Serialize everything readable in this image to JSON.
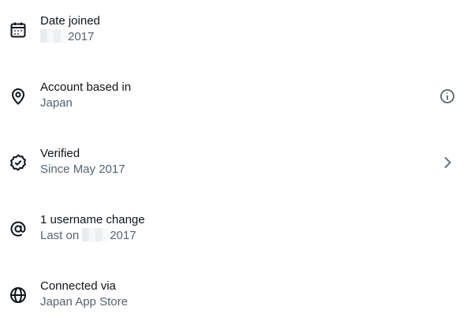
{
  "rows": [
    {
      "icon": "calendar-icon",
      "title": "Date joined",
      "subtitle_suffix": "2017",
      "trailing": null
    },
    {
      "icon": "location-pin-icon",
      "title": "Account based in",
      "subtitle": "Japan",
      "trailing": "info-icon"
    },
    {
      "icon": "verified-badge-icon",
      "title": "Verified",
      "subtitle": "Since May 2017",
      "trailing": "chevron-right-icon"
    },
    {
      "icon": "at-sign-icon",
      "title": "1 username change",
      "subtitle_prefix": "Last on",
      "subtitle_suffix": "2017",
      "trailing": null
    },
    {
      "icon": "globe-icon",
      "title": "Connected via",
      "subtitle": "Japan App Store",
      "trailing": null
    }
  ]
}
